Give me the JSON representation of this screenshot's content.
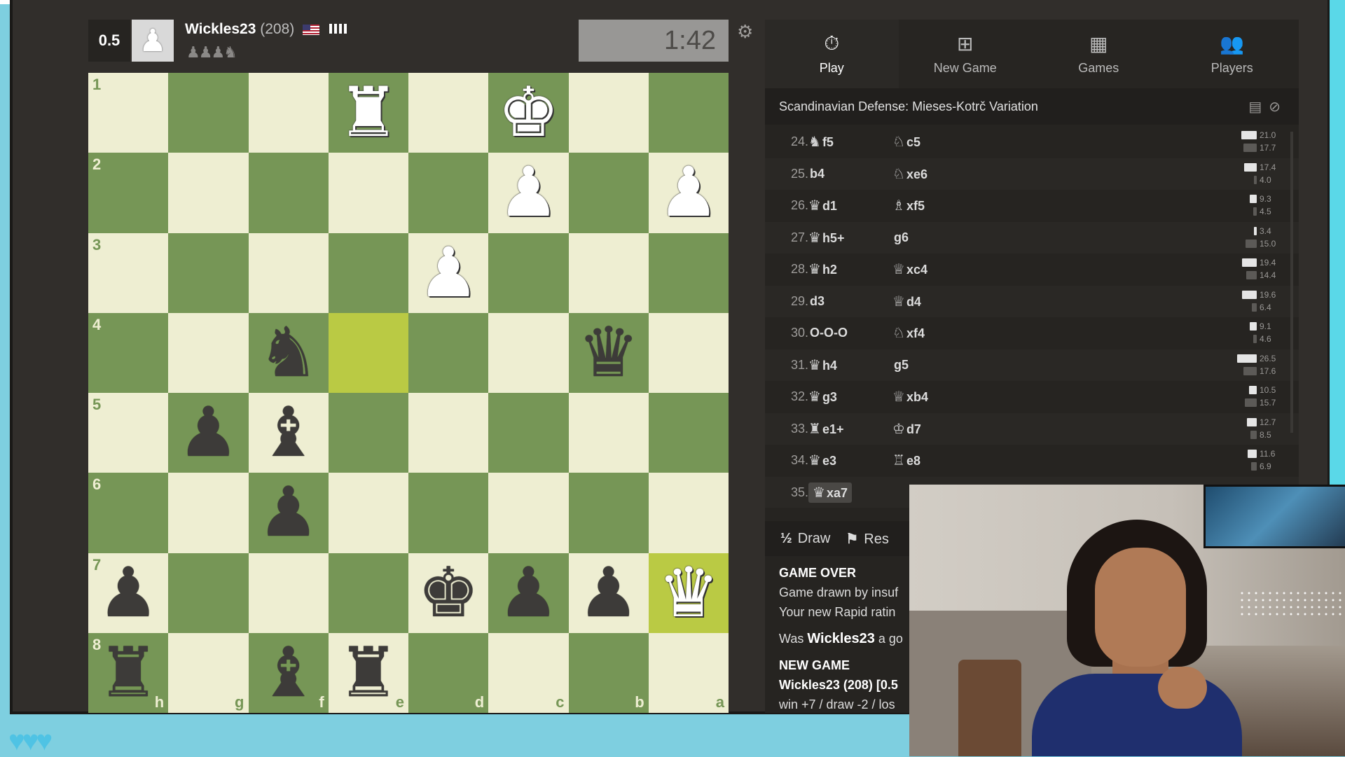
{
  "player": {
    "score": "0.5",
    "name": "Wickles23",
    "rating": "(208)",
    "captured": "♟♟♟♞"
  },
  "clock": "1:42",
  "icons": {
    "settings": "gear-icon",
    "play": "stopwatch-icon",
    "new_game": "plus-square-icon",
    "games": "checkerboard-icon",
    "players": "people-icon"
  },
  "tabs": [
    {
      "label": "Play",
      "icon": "⏱"
    },
    {
      "label": "New Game",
      "icon": "⊞"
    },
    {
      "label": "Games",
      "icon": "▦"
    },
    {
      "label": "Players",
      "icon": "👥"
    }
  ],
  "opening": "Scandinavian Defense: Mieses-Kotrč Variation",
  "moves": [
    {
      "num": "24.",
      "white_icon": "♞",
      "white": "f5",
      "black_icon": "♘",
      "black": "c5",
      "w_eval": "21.0",
      "b_eval": "17.7",
      "w_frac": 0.8,
      "b_frac": 0.68
    },
    {
      "num": "25.",
      "white_icon": "",
      "white": "b4",
      "black_icon": "♘",
      "black": "xe6",
      "w_eval": "17.4",
      "b_eval": "4.0",
      "w_frac": 0.66,
      "b_frac": 0.15
    },
    {
      "num": "26.",
      "white_icon": "♛",
      "white": "d1",
      "black_icon": "♗",
      "black": "xf5",
      "w_eval": "9.3",
      "b_eval": "4.5",
      "w_frac": 0.36,
      "b_frac": 0.17
    },
    {
      "num": "27.",
      "white_icon": "♛",
      "white": "h5+",
      "black_icon": "",
      "black": "g6",
      "w_eval": "3.4",
      "b_eval": "15.0",
      "w_frac": 0.13,
      "b_frac": 0.58
    },
    {
      "num": "28.",
      "white_icon": "♛",
      "white": "h2",
      "black_icon": "♕",
      "black": "xc4",
      "w_eval": "19.4",
      "b_eval": "14.4",
      "w_frac": 0.74,
      "b_frac": 0.55
    },
    {
      "num": "29.",
      "white_icon": "",
      "white": "d3",
      "black_icon": "♕",
      "black": "d4",
      "w_eval": "19.6",
      "b_eval": "6.4",
      "w_frac": 0.75,
      "b_frac": 0.25
    },
    {
      "num": "30.",
      "white_icon": "",
      "white": "O-O-O",
      "black_icon": "♘",
      "black": "xf4",
      "w_eval": "9.1",
      "b_eval": "4.6",
      "w_frac": 0.35,
      "b_frac": 0.18
    },
    {
      "num": "31.",
      "white_icon": "♛",
      "white": "h4",
      "black_icon": "",
      "black": "g5",
      "w_eval": "26.5",
      "b_eval": "17.6",
      "w_frac": 1.0,
      "b_frac": 0.68
    },
    {
      "num": "32.",
      "white_icon": "♛",
      "white": "g3",
      "black_icon": "♕",
      "black": "xb4",
      "w_eval": "10.5",
      "b_eval": "15.7",
      "w_frac": 0.4,
      "b_frac": 0.6
    },
    {
      "num": "33.",
      "white_icon": "♜",
      "white": "e1+",
      "black_icon": "♔",
      "black": "d7",
      "w_eval": "12.7",
      "b_eval": "8.5",
      "w_frac": 0.49,
      "b_frac": 0.33
    },
    {
      "num": "34.",
      "white_icon": "♛",
      "white": "e3",
      "black_icon": "♖",
      "black": "e8",
      "w_eval": "11.6",
      "b_eval": "6.9",
      "w_frac": 0.45,
      "b_frac": 0.27
    },
    {
      "num": "35.",
      "white_icon": "♛",
      "white": "xa7",
      "black_icon": "",
      "black": "",
      "w_eval": "",
      "b_eval": "",
      "w_frac": 0,
      "b_frac": 0
    }
  ],
  "actions": {
    "draw_icon": "½",
    "draw_label": "Draw",
    "resign_label": "Res"
  },
  "chat": {
    "game_over_title": "GAME OVER",
    "game_over_line1": "Game drawn by insuf",
    "game_over_line2": "Your new Rapid ratin",
    "was_prefix": "Was ",
    "was_name": "Wickles23",
    "was_suffix": " a go",
    "new_game_title": "NEW GAME",
    "new_game_player": "Wickles23 (208) [0.5",
    "new_game_odds": "win +7 / draw -2 / los"
  },
  "board": {
    "ranks": [
      "1",
      "2",
      "3",
      "4",
      "5",
      "6",
      "7",
      "8"
    ],
    "files": [
      "h",
      "g",
      "f",
      "e",
      "d",
      "c",
      "b",
      "a"
    ],
    "highlight": [
      "3-3",
      "6-7"
    ],
    "pieces": {
      "0-3": {
        "glyph": "♜",
        "color": "w",
        "name": "white-rook"
      },
      "0-5": {
        "glyph": "♚",
        "color": "w",
        "name": "white-king"
      },
      "1-5": {
        "glyph": "♟",
        "color": "w",
        "name": "white-pawn"
      },
      "1-7": {
        "glyph": "♟",
        "color": "w",
        "name": "white-pawn"
      },
      "2-4": {
        "glyph": "♟",
        "color": "w",
        "name": "white-pawn"
      },
      "3-2": {
        "glyph": "♞",
        "color": "b",
        "name": "black-knight"
      },
      "3-6": {
        "glyph": "♛",
        "color": "b",
        "name": "black-queen"
      },
      "4-1": {
        "glyph": "♟",
        "color": "b",
        "name": "black-pawn"
      },
      "4-2": {
        "glyph": "♝",
        "color": "b",
        "name": "black-bishop"
      },
      "5-2": {
        "glyph": "♟",
        "color": "b",
        "name": "black-pawn"
      },
      "6-0": {
        "glyph": "♟",
        "color": "b",
        "name": "black-pawn"
      },
      "6-4": {
        "glyph": "♚",
        "color": "b",
        "name": "black-king"
      },
      "6-5": {
        "glyph": "♟",
        "color": "b",
        "name": "black-pawn"
      },
      "6-6": {
        "glyph": "♟",
        "color": "b",
        "name": "black-pawn"
      },
      "6-7": {
        "glyph": "♛",
        "color": "w",
        "name": "white-queen"
      },
      "7-0": {
        "glyph": "♜",
        "color": "b",
        "name": "black-rook"
      },
      "7-2": {
        "glyph": "♝",
        "color": "b",
        "name": "black-bishop"
      },
      "7-3": {
        "glyph": "♜",
        "color": "b",
        "name": "black-rook"
      }
    }
  },
  "colors": {
    "light_square": "#eeeed2",
    "dark_square": "#769656",
    "highlight": "#baca44",
    "panel_bg": "#262421"
  }
}
